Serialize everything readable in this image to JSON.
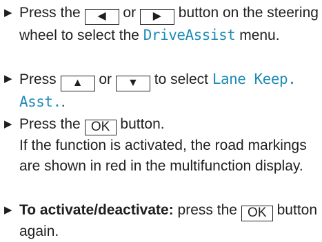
{
  "steps": [
    {
      "pre": "Press the",
      "key_left": "◀",
      "or": "or",
      "key_right": "▶",
      "post": "button on the steering wheel to select the",
      "display": "DriveAssist",
      "tail": "menu."
    },
    {
      "pre": "Press",
      "key_up": "▲",
      "or": "or",
      "key_down": "▼",
      "post": "to select",
      "display_1": "Lane Keep.",
      "display_2": "Asst.",
      "tail": "."
    },
    {
      "pre": "Press the",
      "key_ok": "OK",
      "post": "button.",
      "note": "If the function is activated, the road markings are shown in red in the multifunction display."
    },
    {
      "bold": "To activate/deactivate:",
      "pre": "press the",
      "key_ok": "OK",
      "post": "button again."
    }
  ],
  "bullet_glyph": "▶"
}
